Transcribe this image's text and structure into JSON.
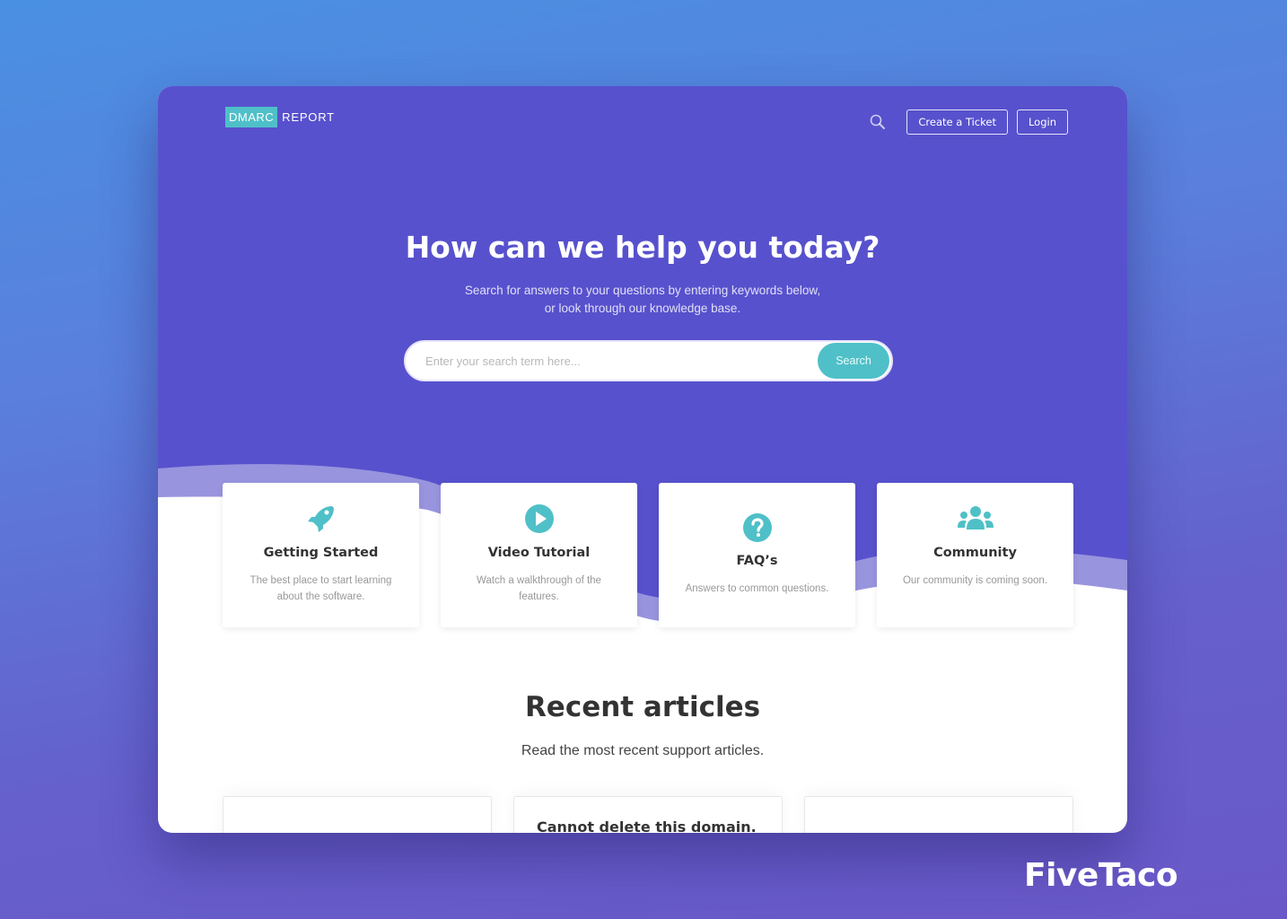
{
  "logo": {
    "box_text": "DMARC",
    "text": "REPORT"
  },
  "nav": {
    "search_icon": "search-icon",
    "create_ticket_label": "Create a Ticket",
    "login_label": "Login"
  },
  "hero": {
    "title": "How can we help you today?",
    "subtitle": "Search for answers to your questions by entering keywords below, or look through our knowledge base.",
    "search": {
      "placeholder": "Enter your search term here...",
      "value": "",
      "button_label": "Search"
    }
  },
  "cards": [
    {
      "icon": "rocket-icon",
      "title": "Getting Started",
      "desc": "The best place to start learning about the software."
    },
    {
      "icon": "play-circle-icon",
      "title": "Video Tutorial",
      "desc": "Watch a walkthrough of the features."
    },
    {
      "icon": "question-circle-icon",
      "title": "FAQ’s",
      "desc": "Answers to common questions."
    },
    {
      "icon": "users-icon",
      "title": "Community",
      "desc": "Our community is coming soon."
    }
  ],
  "recent": {
    "title": "Recent articles",
    "subtitle": "Read the most recent support articles.",
    "articles": [
      {
        "title": ""
      },
      {
        "title": "Cannot delete this domain."
      },
      {
        "title": ""
      }
    ]
  },
  "watermark": "FiveTaco",
  "colors": {
    "primary": "#5751cd",
    "accent": "#4fc0c8",
    "wave": "#9894de"
  }
}
